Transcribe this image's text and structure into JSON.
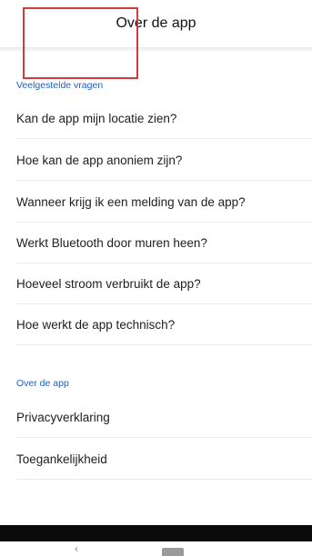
{
  "header": {
    "title": "Over de app"
  },
  "faq": {
    "section_label": "Veelgestelde vragen",
    "items": [
      {
        "label": "Kan de app mijn locatie zien?"
      },
      {
        "label": "Hoe kan de app anoniem zijn?"
      },
      {
        "label": "Wanneer krijg ik een melding van de app?"
      },
      {
        "label": "Werkt Bluetooth door muren heen?"
      },
      {
        "label": "Hoeveel stroom verbruikt de app?"
      },
      {
        "label": "Hoe werkt de app technisch?"
      }
    ]
  },
  "about": {
    "section_label": "Over de app",
    "items": [
      {
        "label": "Privacyverklaring"
      },
      {
        "label": "Toegankelijkheid"
      }
    ]
  },
  "navigation": {
    "back_glyph": "‹"
  },
  "colors": {
    "accent": "#1f5fbf",
    "highlight": "#d43b3b"
  }
}
